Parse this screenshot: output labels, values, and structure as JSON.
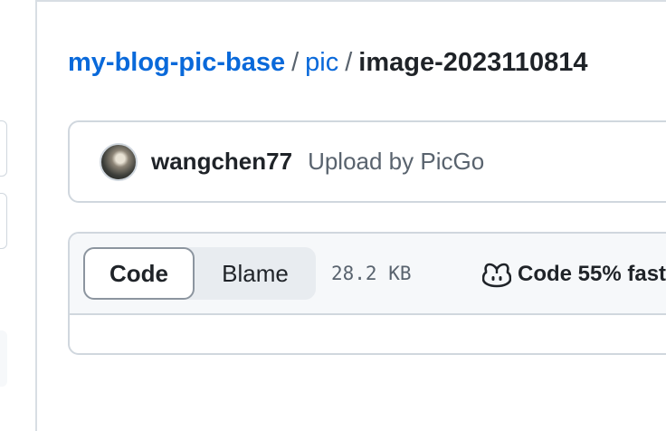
{
  "breadcrumb": {
    "repo": "my-blog-pic-base",
    "separator1": "/",
    "folder": "pic",
    "separator2": "/",
    "file": "image-2023110814"
  },
  "commit": {
    "author": "wangchen77",
    "message": "Upload by PicGo"
  },
  "file_header": {
    "tabs": [
      {
        "label": "Code",
        "selected": true
      },
      {
        "label": "Blame",
        "selected": false
      }
    ],
    "size": "28.2 KB",
    "copilot_icon": "copilot-icon",
    "copilot_text": "Code 55% fast"
  },
  "colors": {
    "link": "#0969da",
    "muted": "#59636e",
    "border": "#d0d7de",
    "header_bg": "#f6f8fa"
  }
}
